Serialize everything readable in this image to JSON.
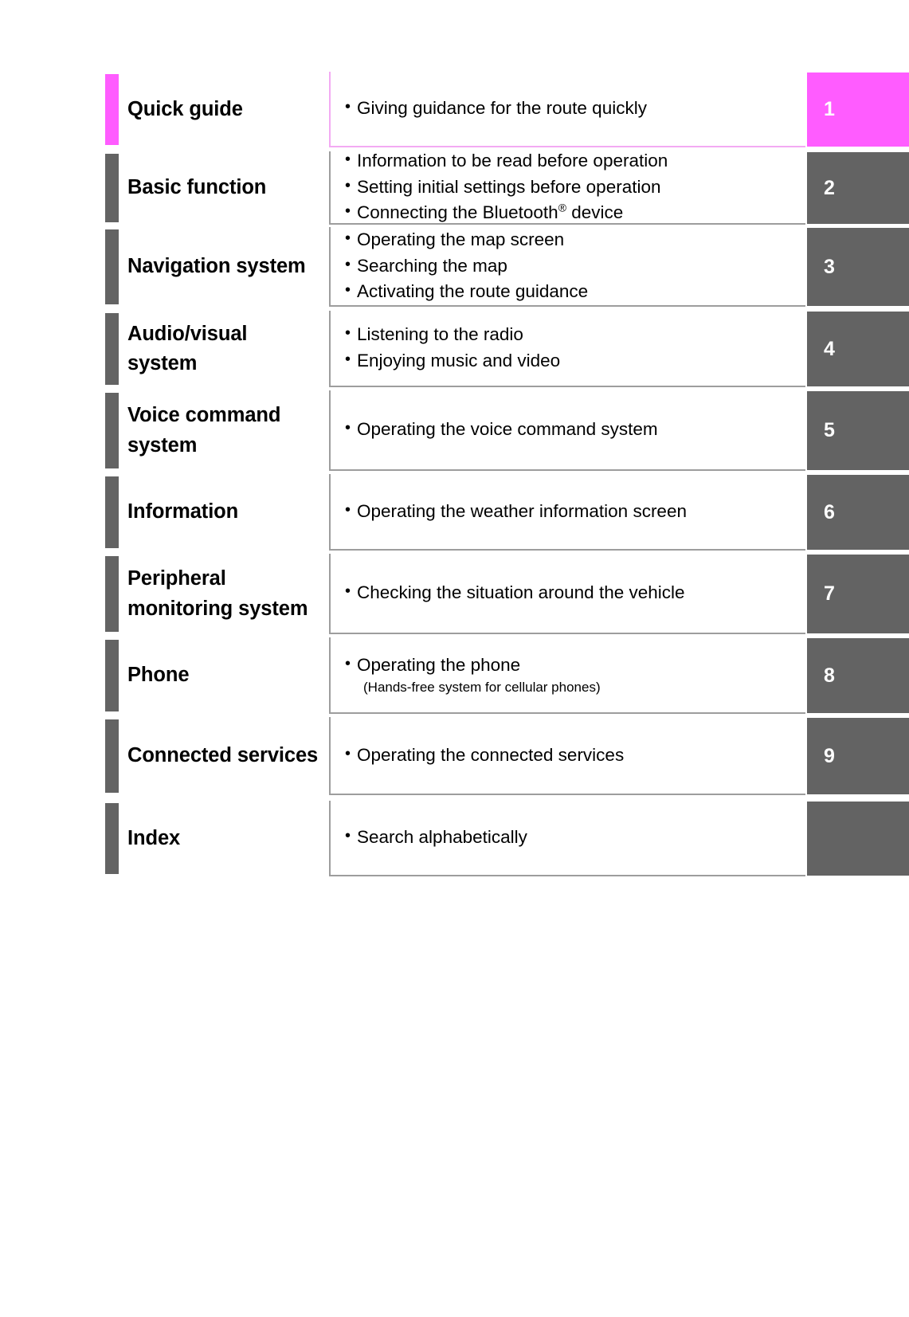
{
  "page": {
    "kind": "table-of-contents",
    "accent_color": "#ff5cff",
    "neutral_color": "#636363",
    "border_color": "#9d9d9d",
    "accent_border_color": "#f3aaf3"
  },
  "rows": [
    {
      "label": "Quick guide",
      "tab_number": "1",
      "accent": true,
      "items": [
        {
          "text": "Giving guidance for the route quickly"
        }
      ]
    },
    {
      "label": "Basic function",
      "tab_number": "2",
      "accent": false,
      "items": [
        {
          "text": "Information to be read before operation"
        },
        {
          "text": "Setting initial settings before operation"
        },
        {
          "text": "Connecting the Bluetooth",
          "superscript": "®",
          "text_after": " device"
        }
      ]
    },
    {
      "label": "Navigation system",
      "tab_number": "3",
      "accent": false,
      "items": [
        {
          "text": "Operating the map screen"
        },
        {
          "text": "Searching the map"
        },
        {
          "text": "Activating the route guidance"
        }
      ]
    },
    {
      "label": "Audio/visual system",
      "tab_number": "4",
      "accent": false,
      "items": [
        {
          "text": "Listening to the radio"
        },
        {
          "text": "Enjoying music and video"
        }
      ]
    },
    {
      "label": "Voice command system",
      "tab_number": "5",
      "accent": false,
      "items": [
        {
          "text": "Operating the voice command system"
        }
      ]
    },
    {
      "label": "Information",
      "tab_number": "6",
      "accent": false,
      "items": [
        {
          "text": "Operating the weather information screen"
        }
      ]
    },
    {
      "label": "Peripheral monitoring system",
      "tab_number": "7",
      "accent": false,
      "items": [
        {
          "text": "Checking the situation around the vehicle"
        }
      ]
    },
    {
      "label": "Phone",
      "tab_number": "8",
      "accent": false,
      "items": [
        {
          "text": "Operating the phone",
          "note": "(Hands-free system for cellular phones)"
        }
      ]
    },
    {
      "label": "Connected services",
      "tab_number": "9",
      "accent": false,
      "items": [
        {
          "text": "Operating the connected services"
        }
      ]
    },
    {
      "label": "Index",
      "tab_number": "",
      "accent": false,
      "items": [
        {
          "text": "Search alphabetically"
        }
      ]
    }
  ]
}
